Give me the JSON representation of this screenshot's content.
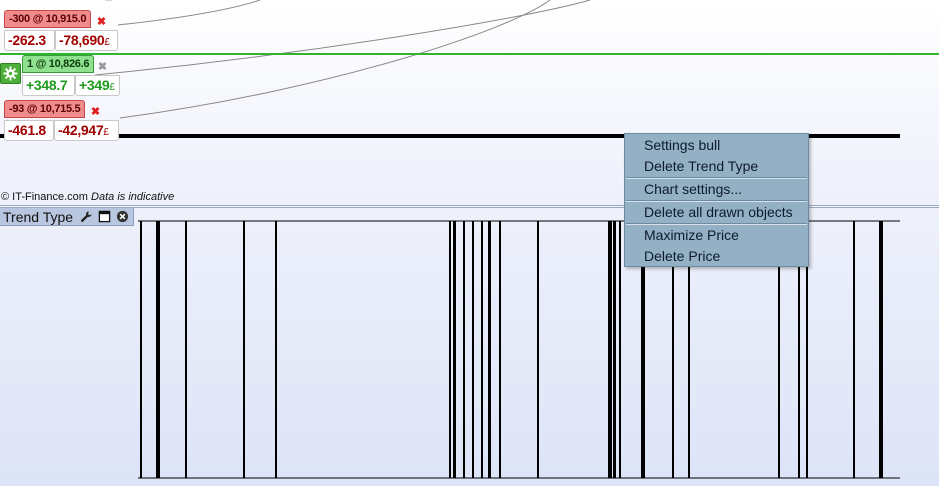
{
  "positions": [
    {
      "id": "pos-1",
      "tag": "-300 @ 10,915.0",
      "points": "-262.3",
      "pnl": "-78,690",
      "currency": "£",
      "side": "short"
    },
    {
      "id": "pos-2",
      "tag": "1 @ 10,826.6",
      "points": "+348.7",
      "pnl": "+349",
      "currency": "£",
      "side": "long"
    },
    {
      "id": "pos-3",
      "tag": "-93 @ 10,715.5",
      "points": "-461.8",
      "pnl": "-42,947",
      "currency": "£",
      "side": "short"
    }
  ],
  "footer": {
    "copyright": "© IT-Finance.com",
    "note": "Data is indicative"
  },
  "indicator_panel": {
    "title": "Trend Type"
  },
  "icons": {
    "gear": "gear-icon",
    "wrench": "wrench-icon",
    "window": "window-icon",
    "close": "close-circle-icon",
    "delete": "close-x-icon"
  },
  "colors": {
    "short_tag": "#f28b8b",
    "long_tag": "#8fe08f",
    "negative_value": "#a00000",
    "positive_value": "#1f9a1f",
    "current_price_line": "#2fb52f",
    "menu_background": "#93b0c4"
  },
  "context_menu": {
    "items": [
      "Settings bull",
      "Delete Trend Type",
      "Chart settings...",
      "Delete all drawn objects",
      "Maximize Price",
      "Delete Price"
    ]
  }
}
